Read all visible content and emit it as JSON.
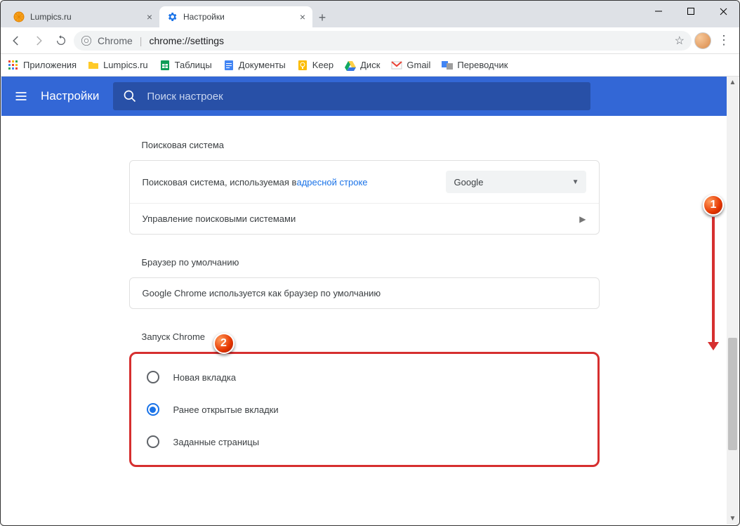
{
  "window": {
    "tabs": [
      {
        "title": "Lumpics.ru",
        "active": false
      },
      {
        "title": "Настройки",
        "active": true
      }
    ]
  },
  "omnibox": {
    "scheme": "Chrome",
    "path": "chrome://settings"
  },
  "bookmarks": [
    {
      "label": "Приложения",
      "icon": "apps"
    },
    {
      "label": "Lumpics.ru",
      "icon": "folder"
    },
    {
      "label": "Таблицы",
      "icon": "sheets"
    },
    {
      "label": "Документы",
      "icon": "docs"
    },
    {
      "label": "Keep",
      "icon": "keep"
    },
    {
      "label": "Диск",
      "icon": "drive"
    },
    {
      "label": "Gmail",
      "icon": "gmail"
    },
    {
      "label": "Переводчик",
      "icon": "translate"
    }
  ],
  "settings_header": {
    "title": "Настройки",
    "search_placeholder": "Поиск настроек"
  },
  "sections": {
    "search_engine": {
      "title": "Поисковая система",
      "row1_prefix": "Поисковая система, используемая в ",
      "row1_link": "адресной строке",
      "row1_value": "Google",
      "row2": "Управление поисковыми системами"
    },
    "default_browser": {
      "title": "Браузер по умолчанию",
      "text": "Google Chrome используется как браузер по умолчанию"
    },
    "on_startup": {
      "title": "Запуск Chrome",
      "options": [
        {
          "label": "Новая вкладка",
          "checked": false
        },
        {
          "label": "Ранее открытые вкладки",
          "checked": true
        },
        {
          "label": "Заданные страницы",
          "checked": false
        }
      ]
    }
  },
  "annotations": {
    "badge1": "1",
    "badge2": "2"
  }
}
